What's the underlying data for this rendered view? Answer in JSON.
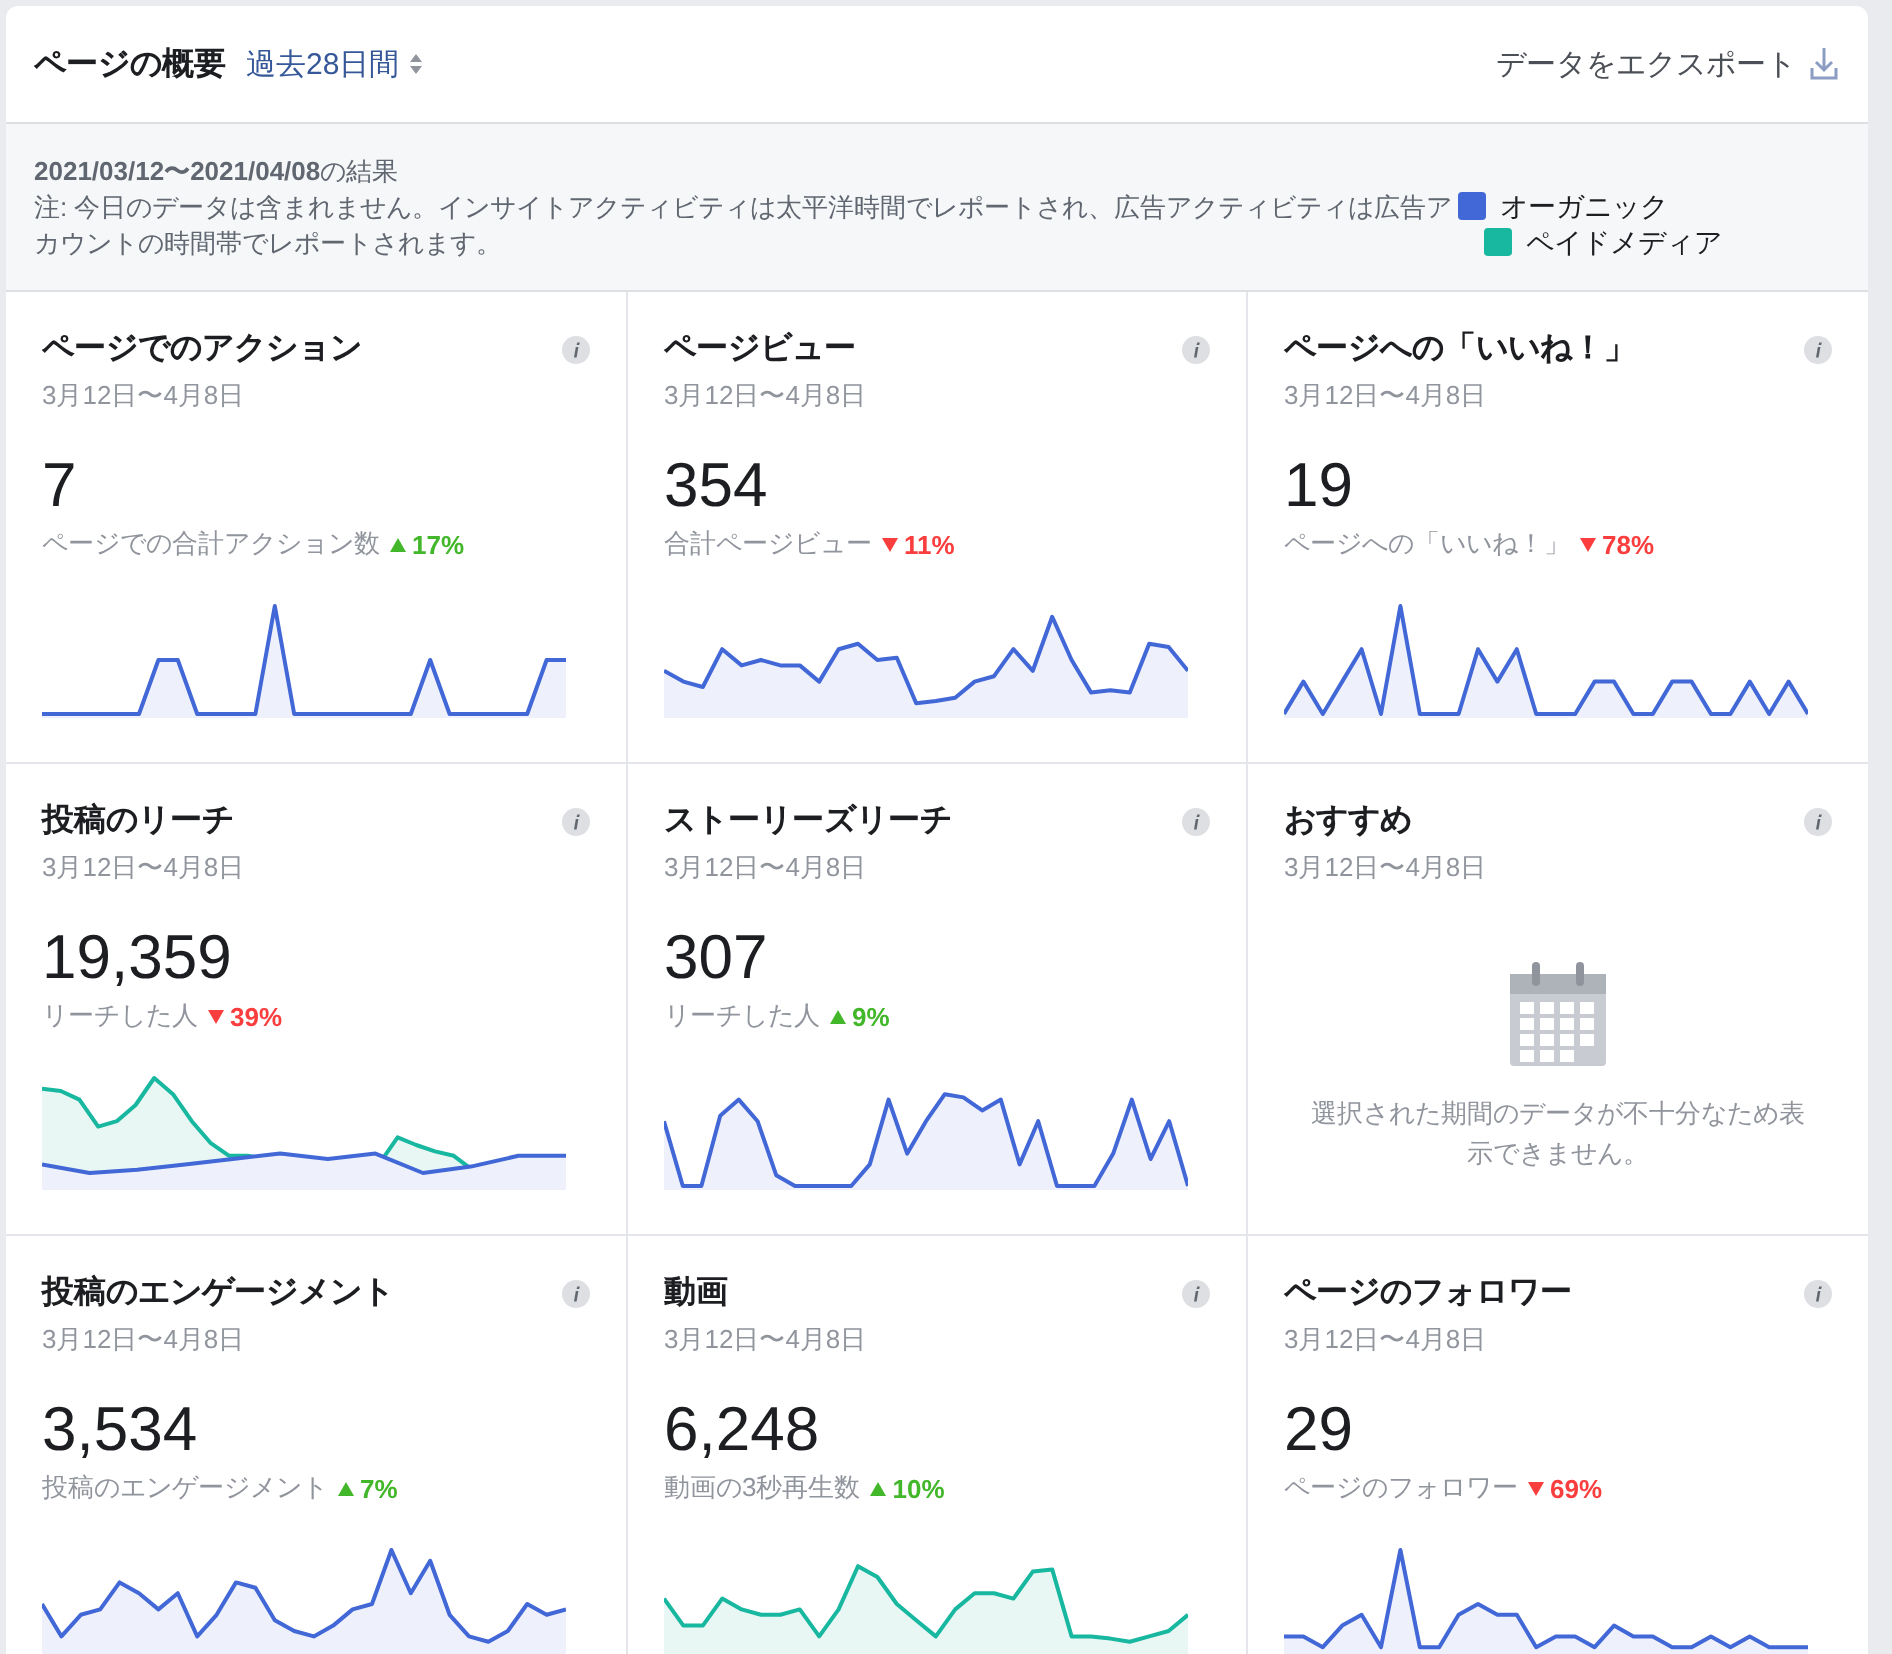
{
  "header": {
    "title": "ページの概要",
    "period": "過去28日間",
    "export": "データをエクスポート"
  },
  "info": {
    "range": "2021/03/12〜2021/04/08",
    "range_suffix": "の結果",
    "note": "注: 今日のデータは含まれません。インサイトアクティビティは太平洋時間でレポートされ、広告アクティビティは広告アカウントの時間帯でレポートされます。"
  },
  "legend": [
    {
      "label": "オーガニック",
      "color": "#4267d6"
    },
    {
      "label": "ペイドメディア",
      "color": "#17b7a0"
    }
  ],
  "cards": [
    {
      "kind": "metric",
      "title": "ページでのアクション",
      "dates": "3月12日〜4月8日",
      "value": "7",
      "caption": "ページでの合計アクション数",
      "rising": true,
      "change": "17%"
    },
    {
      "kind": "metric",
      "title": "ページビュー",
      "dates": "3月12日〜4月8日",
      "value": "354",
      "caption": "合計ページビュー",
      "rising": false,
      "change": "11%"
    },
    {
      "kind": "metric",
      "title": "ページへの「いいね！」",
      "dates": "3月12日〜4月8日",
      "value": "19",
      "caption": "ページへの「いいね！」",
      "rising": false,
      "change": "78%"
    },
    {
      "kind": "metric",
      "title": "投稿のリーチ",
      "dates": "3月12日〜4月8日",
      "value": "19,359",
      "caption": "リーチした人",
      "rising": false,
      "change": "39%"
    },
    {
      "kind": "metric",
      "title": "ストーリーズリーチ",
      "dates": "3月12日〜4月8日",
      "value": "307",
      "caption": "リーチした人",
      "rising": true,
      "change": "9%"
    },
    {
      "kind": "empty",
      "title": "おすすめ",
      "dates": "3月12日〜4月8日",
      "message": "選択された期間のデータが不十分なため表示できません。"
    },
    {
      "kind": "metric",
      "title": "投稿のエンゲージメント",
      "dates": "3月12日〜4月8日",
      "value": "3,534",
      "caption": "投稿のエンゲージメント",
      "rising": true,
      "change": "7%"
    },
    {
      "kind": "metric",
      "title": "動画",
      "dates": "3月12日〜4月8日",
      "value": "6,248",
      "caption": "動画の3秒再生数",
      "rising": true,
      "change": "10%"
    },
    {
      "kind": "metric",
      "title": "ページのフォロワー",
      "dates": "3月12日〜4月8日",
      "value": "29",
      "caption": "ページのフォロワー",
      "rising": false,
      "change": "69%"
    }
  ]
}
